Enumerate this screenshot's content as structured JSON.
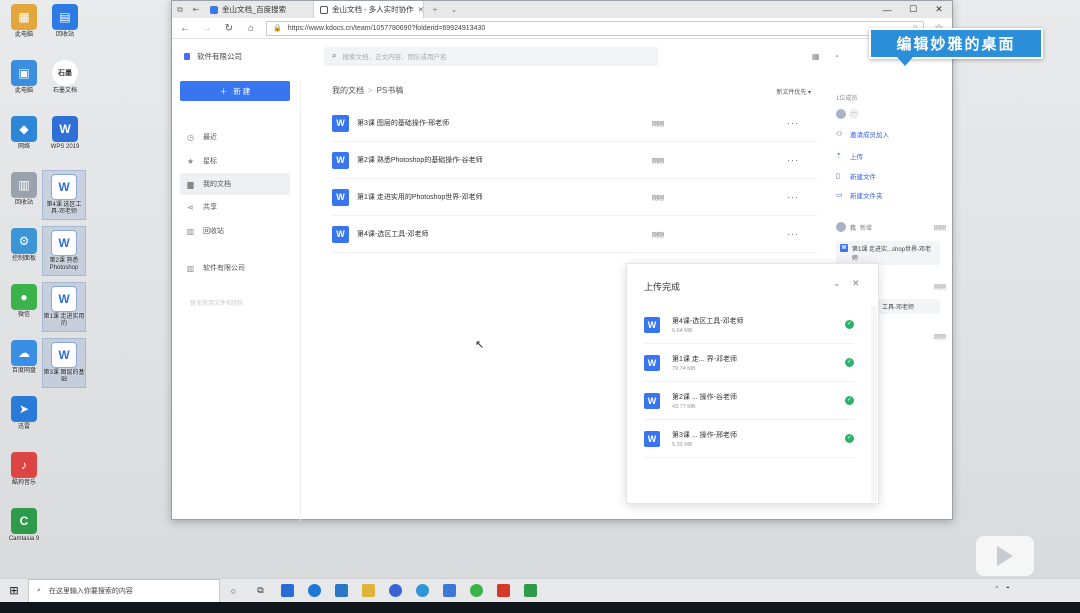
{
  "desktop": {
    "icons": [
      {
        "label": "此电脑",
        "glyph": "PC",
        "color": "#e2a63a"
      },
      {
        "label": "回收站",
        "glyph": "▤",
        "color": "#2c7be5"
      },
      {
        "label": "此电脑",
        "glyph": "▣",
        "color": "#3c8de0"
      },
      {
        "label": "石墨文档",
        "glyph": "石墨",
        "color": "#ffffff"
      },
      {
        "label": "网络",
        "glyph": "◆",
        "color": "#2e86d6"
      },
      {
        "label": "WPS 2019",
        "glyph": "W",
        "color": "#2f6fd6"
      },
      {
        "label": "回收站",
        "glyph": "🗑",
        "color": "#9aa3ad"
      },
      {
        "label": "第4课 选区工具-邓老师",
        "glyph": "W",
        "color": "#ffffff"
      },
      {
        "label": "控制面板",
        "glyph": "⚙",
        "color": "#3b95d6"
      },
      {
        "label": "第2课 熟悉Photoshop",
        "glyph": "W",
        "color": "#ffffff"
      },
      {
        "label": "微信",
        "glyph": "●",
        "color": "#3cb34a"
      },
      {
        "label": "第1课 走进实用的",
        "glyph": "W",
        "color": "#ffffff"
      },
      {
        "label": "百度网盘",
        "glyph": "☁",
        "color": "#3a8ee6"
      },
      {
        "label": "第3课 图层的基础",
        "glyph": "W",
        "color": "#ffffff"
      },
      {
        "label": "迅雷",
        "glyph": "➤",
        "color": "#2a7ad8"
      },
      {
        "label": "酷狗音乐",
        "glyph": "♪",
        "color": "#d44"
      },
      {
        "label": "Camtasia 9",
        "glyph": "C",
        "color": "#2e9a4a"
      }
    ]
  },
  "browser": {
    "tabs": [
      {
        "label": "金山文档_百度搜索",
        "icon_color": "#3a78e8"
      },
      {
        "label": "金山文档 - 多人实时协作",
        "icon_color": "#555555"
      }
    ],
    "url": "https://www.kdocs.cn/team/1057780690?folderid=69924913430"
  },
  "app": {
    "company": "软件有限公司",
    "search_placeholder": "搜索文档、正文内容、团队或用户名",
    "new_button": "新 建",
    "sidebar": [
      {
        "label": "最近",
        "icon": "clock-icon",
        "glyph": "◷"
      },
      {
        "label": "星标",
        "icon": "star-icon",
        "glyph": "★"
      },
      {
        "label": "我的文档",
        "icon": "folder-icon",
        "glyph": "▆"
      },
      {
        "label": "共享",
        "icon": "share-icon",
        "glyph": "<"
      },
      {
        "label": "回收站",
        "icon": "trash-icon",
        "glyph": "▥"
      },
      {
        "label": "软件有限公司",
        "icon": "company-icon",
        "glyph": "▥"
      }
    ],
    "sidebar_note": "暂无常用文件和团队",
    "breadcrumb": [
      "我的文档",
      "PS书稿"
    ],
    "sort_label": "新文件优先 ▾",
    "files": [
      {
        "name": "第3课 图层的基础操作-邢老师",
        "time": "刚刚"
      },
      {
        "name": "第2课 熟悉Photoshop的基础操作-谷老师",
        "time": "刚刚"
      },
      {
        "name": "第1课 走进实用的Photoshop世界-邓老师",
        "time": "刚刚"
      },
      {
        "name": "第4课-选区工具-邓老师",
        "time": "刚刚"
      }
    ],
    "right_panel": {
      "members_title": "1位成员",
      "invite": "邀请成员加入",
      "upload": "上传",
      "new_file": "新建文件",
      "new_folder": "新建文件夹",
      "log_user": "我",
      "log_action": "新增",
      "log_time": "刚刚",
      "card_text": "第1课 走进实...shop世界-邓老师",
      "log_time2": "刚刚",
      "card2_text": "工具-邓老师",
      "log_time3": "刚刚"
    },
    "upload_panel": {
      "title": "上传完成",
      "items": [
        {
          "name": "第4课-选区工具-邓老师",
          "size": "6.64 MB"
        },
        {
          "name": "第1课 走... 界-邓老师",
          "size": "79.74 MB"
        },
        {
          "name": "第2课 ... 操作-谷老师",
          "size": "43.77 MB"
        },
        {
          "name": "第3课 ... 操作-邢老师",
          "size": "5.39 MB"
        }
      ]
    }
  },
  "watermark": "编辑妙雅的桌面",
  "taskbar": {
    "search_placeholder": "在这里输入你要搜索的内容",
    "apps": [
      {
        "name": "cortana",
        "color": "#333333"
      },
      {
        "name": "task-view",
        "color": "#333333"
      },
      {
        "name": "store",
        "color": "#2b6cd4"
      },
      {
        "name": "edge",
        "color": "#1e78d6"
      },
      {
        "name": "mail",
        "color": "#2a76c8"
      },
      {
        "name": "explorer",
        "color": "#e2b33a"
      },
      {
        "name": "baidu",
        "color": "#3a63d8"
      },
      {
        "name": "telegram",
        "color": "#2f95d6"
      },
      {
        "name": "tool",
        "color": "#3a7ad6"
      },
      {
        "name": "wechat",
        "color": "#3cb34a"
      },
      {
        "name": "pdf",
        "color": "#d33a2c"
      },
      {
        "name": "camtasia",
        "color": "#2e9a4a"
      }
    ]
  }
}
